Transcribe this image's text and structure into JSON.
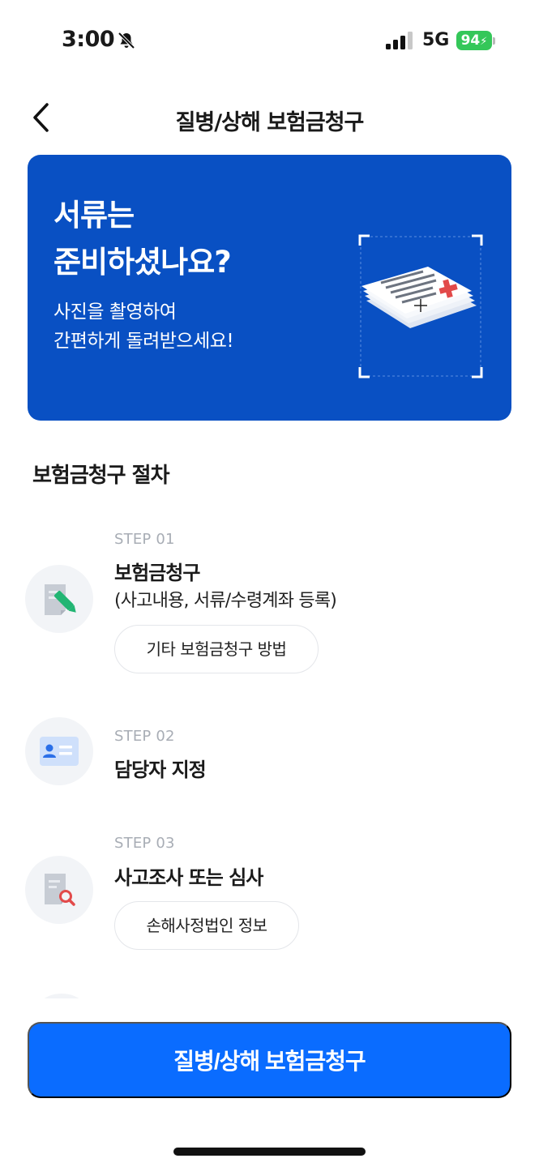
{
  "status_bar": {
    "time": "3:00",
    "network": "5G",
    "battery": "94"
  },
  "nav": {
    "title": "질병/상해 보험금청구"
  },
  "hero": {
    "title_line1": "서류는",
    "title_line2": "준비하셨나요?",
    "subtitle_line1": "사진을 촬영하여",
    "subtitle_line2": "간편하게 돌려받으세요!",
    "background_color": "#0950c3"
  },
  "procedure": {
    "section_title": "보험금청구 절차",
    "steps": [
      {
        "label": "STEP 01",
        "title": "보험금청구",
        "description": "(사고내용, 서류/수령계좌 등록)",
        "button": "기타 보험금청구 방법",
        "icon": "document-edit-icon"
      },
      {
        "label": "STEP 02",
        "title": "담당자 지정",
        "icon": "id-card-icon"
      },
      {
        "label": "STEP 03",
        "title": "사고조사 또는 심사",
        "button": "손해사정법인 정보",
        "icon": "document-search-icon"
      }
    ]
  },
  "cta": {
    "label": "질병/상해 보험금청구",
    "color": "#0a6cff"
  }
}
